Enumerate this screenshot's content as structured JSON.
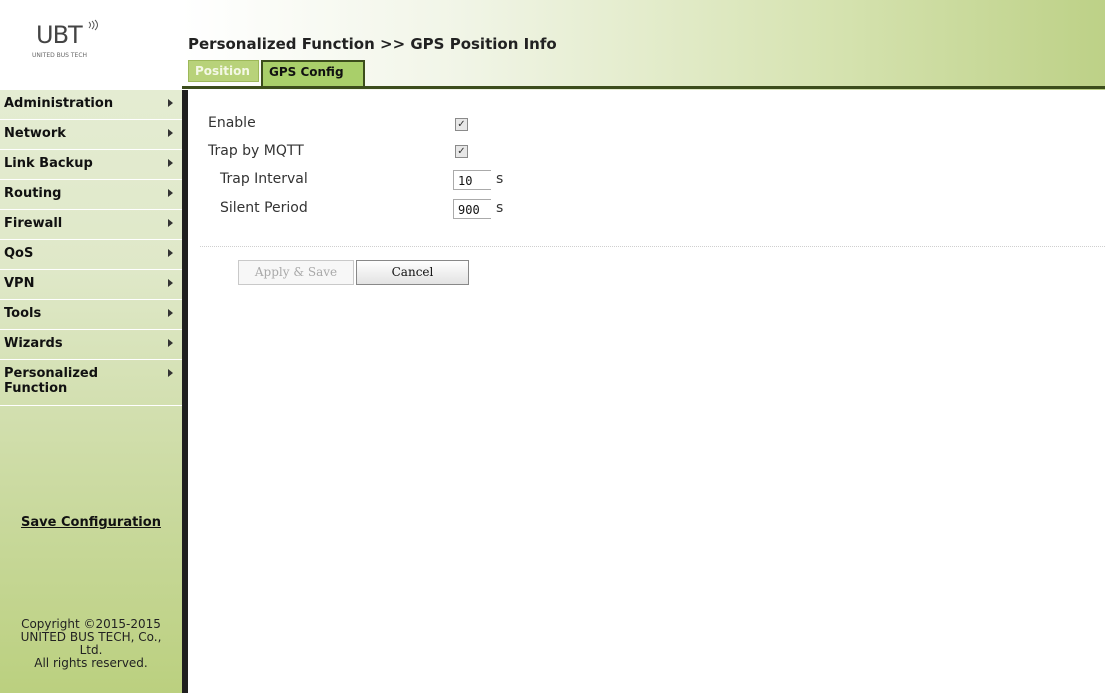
{
  "logo": {
    "mark": "UBT",
    "subtitle": "UNITED BUS TECH"
  },
  "header": {
    "title": "Personalized Function >> GPS Position Info",
    "tabs": [
      {
        "label": "Position",
        "active": false
      },
      {
        "label": "GPS Config",
        "active": true
      }
    ]
  },
  "sidebar": {
    "items": [
      {
        "label": "Administration"
      },
      {
        "label": "Network"
      },
      {
        "label": "Link Backup"
      },
      {
        "label": "Routing"
      },
      {
        "label": "Firewall"
      },
      {
        "label": "QoS"
      },
      {
        "label": "VPN"
      },
      {
        "label": "Tools"
      },
      {
        "label": "Wizards"
      },
      {
        "label": "Personalized Function"
      }
    ],
    "save_label": "Save Configuration",
    "copyright": [
      "Copyright ©2015-2015",
      "UNITED BUS TECH, Co.,",
      "Ltd.",
      "All rights reserved."
    ]
  },
  "form": {
    "enable": {
      "label": "Enable",
      "checked": true
    },
    "trap_mqtt": {
      "label": "Trap by MQTT",
      "checked": true
    },
    "trap_interval": {
      "label": "Trap Interval",
      "value": "10",
      "unit": "s"
    },
    "silent_period": {
      "label": "Silent Period",
      "value": "900",
      "unit": "s"
    },
    "apply_label": "Apply & Save",
    "cancel_label": "Cancel"
  },
  "colors": {
    "accent_green": "#a9cf6a",
    "dark_green_border": "#3c4d1c"
  }
}
